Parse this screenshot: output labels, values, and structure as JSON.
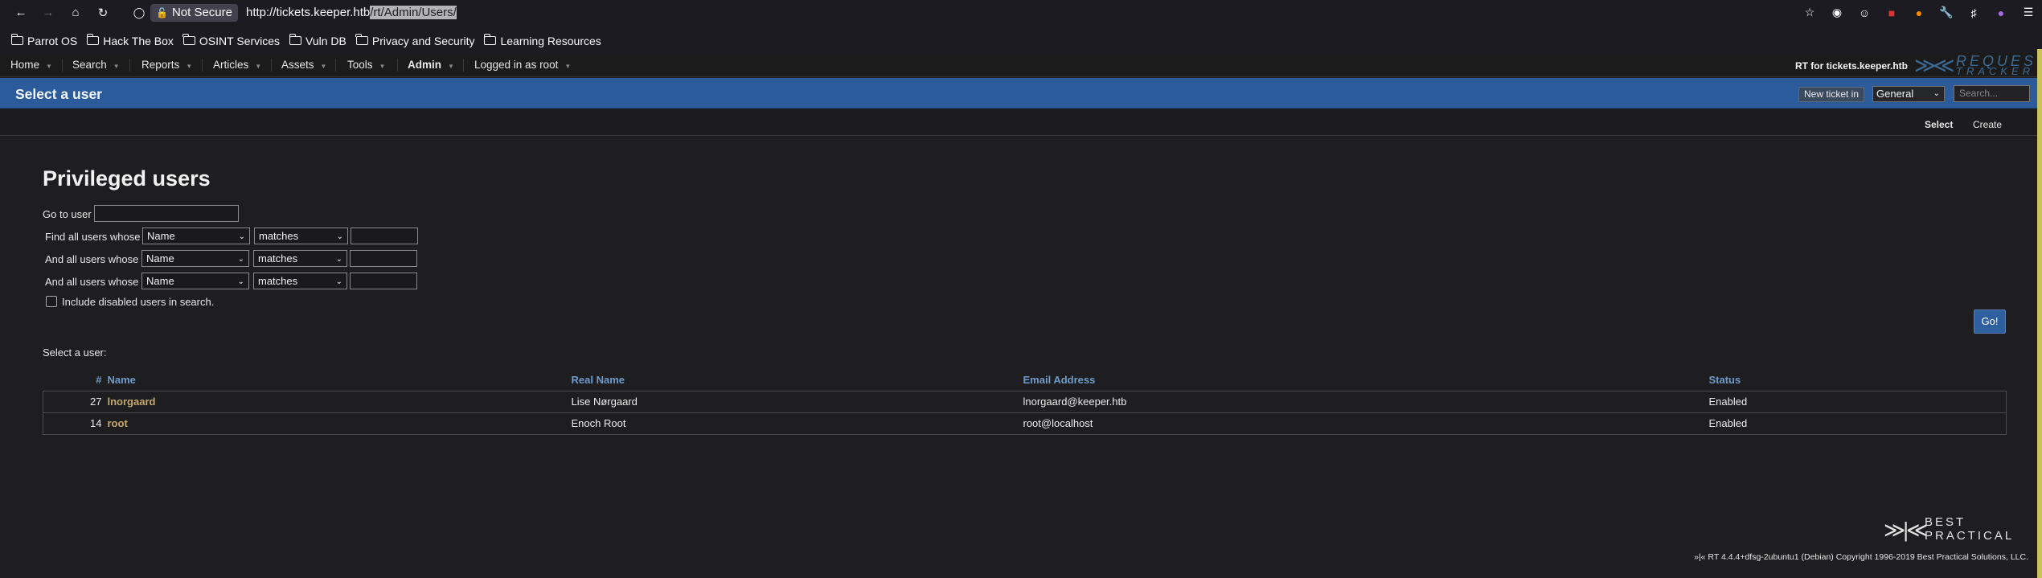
{
  "browser": {
    "security_label": "Not Secure",
    "url_plain": "http://tickets.keeper.htb",
    "url_selected": "/rt/Admin/Users/",
    "nav": [
      "back-icon",
      "forward-icon",
      "home-icon",
      "reload-icon"
    ],
    "right_icons": [
      "bookmark-star-icon",
      "mask-icon",
      "account-icon",
      "ublock-icon",
      "firefox-icon",
      "wrench-icon",
      "extensions-icon",
      "profile-icon",
      "hamburger-menu-icon"
    ],
    "bookmarks": [
      {
        "label": "Parrot OS"
      },
      {
        "label": "Hack The Box"
      },
      {
        "label": "OSINT Services"
      },
      {
        "label": "Vuln DB"
      },
      {
        "label": "Privacy and Security"
      },
      {
        "label": "Learning Resources"
      }
    ]
  },
  "rt_menu": {
    "items": [
      {
        "label": "Home"
      },
      {
        "label": "Search"
      },
      {
        "label": "Reports"
      },
      {
        "label": "Articles"
      },
      {
        "label": "Assets"
      },
      {
        "label": "Tools"
      },
      {
        "label": "Admin"
      },
      {
        "label": "Logged in as root"
      }
    ],
    "rt_for": "RT for tickets.keeper.htb",
    "logo_top": "REQUEST",
    "logo_bottom": "TRACKER"
  },
  "header": {
    "title": "Select a user",
    "new_ticket_label": "New ticket in",
    "queue_value": "General",
    "search_placeholder": "Search..."
  },
  "page_menu": {
    "select": "Select",
    "create": "Create"
  },
  "main": {
    "heading": "Privileged users",
    "go_to_user": "Go to user",
    "filters": [
      {
        "label": "Find all users whose",
        "field": "Name",
        "op": "matches",
        "value": ""
      },
      {
        "label": "And all users whose",
        "field": "Name",
        "op": "matches",
        "value": ""
      },
      {
        "label": "And all users whose",
        "field": "Name",
        "op": "matches",
        "value": ""
      }
    ],
    "include_disabled": "Include disabled users in search.",
    "go_button": "Go!",
    "select_a_user": "Select a user:",
    "table": {
      "headers": {
        "id": "#",
        "name": "Name",
        "real_name": "Real Name",
        "email": "Email Address",
        "status": "Status"
      },
      "rows": [
        {
          "id": "27",
          "name": "lnorgaard",
          "real_name": "Lise Nørgaard",
          "email": "lnorgaard@keeper.htb",
          "status": "Enabled"
        },
        {
          "id": "14",
          "name": "root",
          "real_name": "Enoch Root",
          "email": "root@localhost",
          "status": "Enabled"
        }
      ]
    }
  },
  "footer": {
    "logo_top": "BEST",
    "logo_bottom": "PRACTICAL",
    "text": "»|« RT 4.4.4+dfsg-2ubuntu1 (Debian) Copyright 1996-2019 Best Practical Solutions, LLC."
  }
}
